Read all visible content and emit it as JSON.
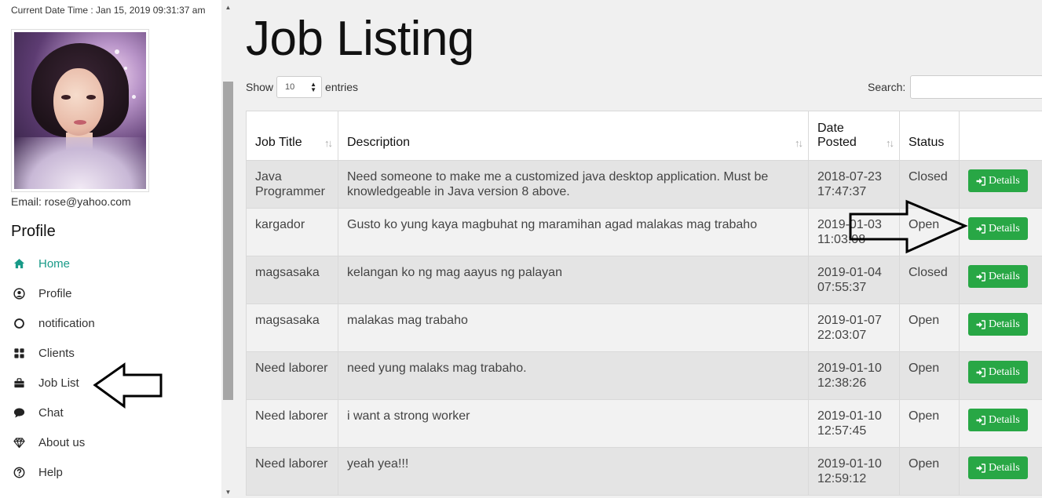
{
  "header": {
    "datetime": "Current Date Time : Jan 15, 2019 09:31:37 am"
  },
  "user": {
    "email": "Email: rose@yahoo.com",
    "avatar_icon": "user-avatar-portrait"
  },
  "sidebar": {
    "heading": "Profile",
    "active_color": "#189a88",
    "items": [
      {
        "label": "Home",
        "icon": "home-icon"
      },
      {
        "label": "Profile",
        "icon": "user-circle-icon"
      },
      {
        "label": "notification",
        "icon": "circle-icon"
      },
      {
        "label": "Clients",
        "icon": "grid-icon"
      },
      {
        "label": "Job List",
        "icon": "briefcase-icon"
      },
      {
        "label": "Chat",
        "icon": "chat-bubble-icon"
      },
      {
        "label": "About us",
        "icon": "diamond-icon"
      },
      {
        "label": "Help",
        "icon": "question-circle-icon"
      }
    ]
  },
  "main": {
    "title": "Job Listing",
    "show_label": "Show",
    "entries_value": "10",
    "entries_label": "entries",
    "search_label": "Search:",
    "search_value": ""
  },
  "table": {
    "columns": [
      "Job Title",
      "Description",
      "Date Posted",
      "Status",
      ""
    ],
    "button_label": "Details",
    "button_color": "#28a745",
    "rows": [
      {
        "title": "Java Programmer",
        "description": "Need someone to make me a customized java desktop application. Must be knowledgeable in Java version 8 above.",
        "date": "2018-07-23",
        "time": "17:47:37",
        "status": "Closed"
      },
      {
        "title": "kargador",
        "description": "Gusto ko yung kaya magbuhat ng maramihan agad malakas mag trabaho",
        "date": "2019-01-03",
        "time": "11:03:08",
        "status": "Open"
      },
      {
        "title": "magsasaka",
        "description": "kelangan ko ng mag aayus ng palayan",
        "date": "2019-01-04",
        "time": "07:55:37",
        "status": "Closed"
      },
      {
        "title": "magsasaka",
        "description": "malakas mag trabaho",
        "date": "2019-01-07",
        "time": "22:03:07",
        "status": "Open"
      },
      {
        "title": "Need laborer",
        "description": "need yung malaks mag trabaho.",
        "date": "2019-01-10",
        "time": "12:38:26",
        "status": "Open"
      },
      {
        "title": "Need laborer",
        "description": "i want a strong worker",
        "date": "2019-01-10",
        "time": "12:57:45",
        "status": "Open"
      },
      {
        "title": "Need laborer",
        "description": "yeah yea!!!",
        "date": "2019-01-10",
        "time": "12:59:12",
        "status": "Open"
      }
    ]
  }
}
